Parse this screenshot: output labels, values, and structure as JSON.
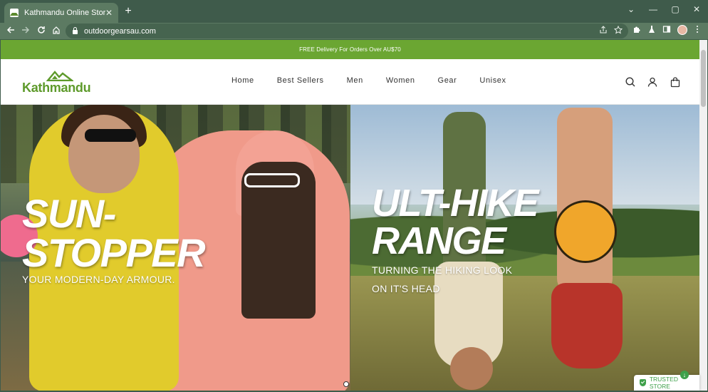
{
  "browser": {
    "tab_title": "Kathmandu Online Store",
    "tab_close": "✕",
    "new_tab": "+",
    "url": "outdoorgearsau.com",
    "window": {
      "dropdown": "⌄",
      "minimize": "—",
      "maximize": "▢",
      "close": "✕"
    }
  },
  "promo": {
    "text": "FREE Delivery For Orders Over AU$70"
  },
  "header": {
    "logo_text": "Kathmandu",
    "nav": [
      "Home",
      "Best Sellers",
      "Men",
      "Women",
      "Gear",
      "Unisex"
    ]
  },
  "hero": {
    "left": {
      "headline_line1": "SUN-",
      "headline_line2": "STOPPER",
      "subtitle": "YOUR MODERN-DAY ARMOUR."
    },
    "right": {
      "headline_line1": "ULT-HIKE",
      "headline_line2": "RANGE",
      "subtitle_line1": "TURNING THE HIKING LOOK",
      "subtitle_line2": "ON IT'S HEAD"
    }
  },
  "trust_badge": {
    "label": "TRUSTED STORE"
  },
  "colors": {
    "promo_bar": "#6ba632",
    "logo_green": "#5e9a2b",
    "browser_frame": "#3f5b4b"
  }
}
